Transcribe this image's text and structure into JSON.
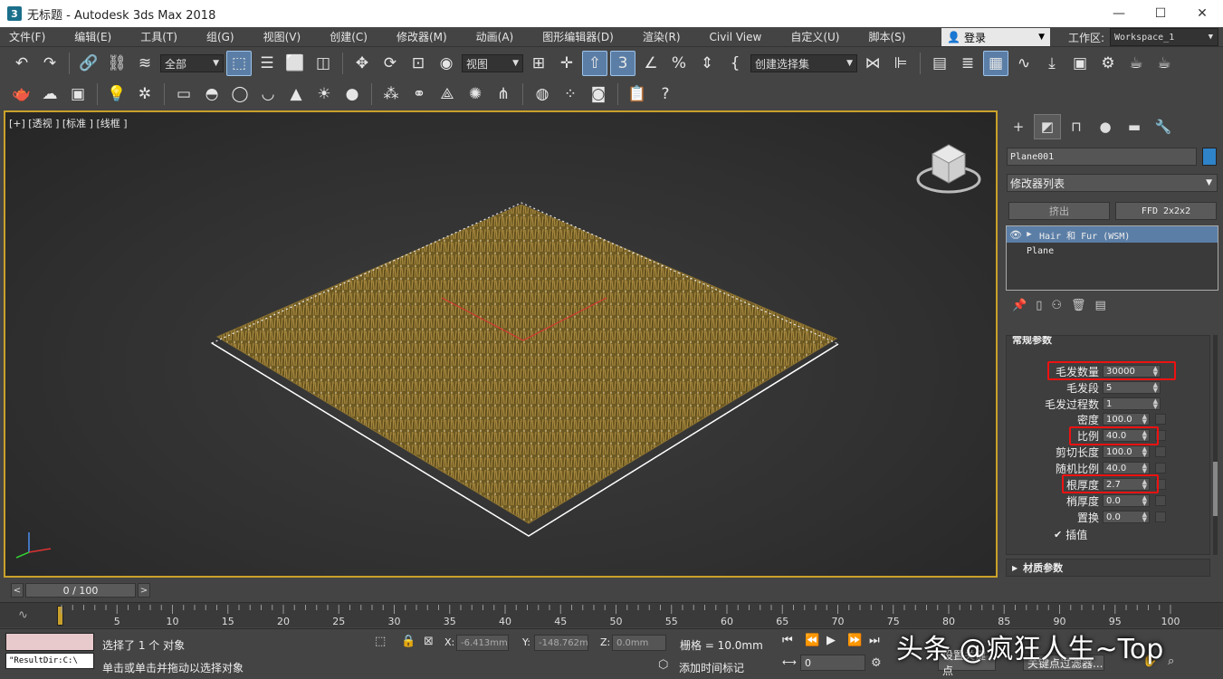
{
  "window": {
    "title": "无标题 - Autodesk 3ds Max 2018",
    "logo": "3",
    "minimize": "—",
    "maximize": "☐",
    "close": "✕"
  },
  "menu": [
    "文件(F)",
    "编辑(E)",
    "工具(T)",
    "组(G)",
    "视图(V)",
    "创建(C)",
    "修改器(M)",
    "动画(A)",
    "图形编辑器(D)",
    "渲染(R)",
    "Civil View",
    "自定义(U)",
    "脚本(S)"
  ],
  "login": {
    "icon": "👤",
    "label": "登录"
  },
  "workspace": {
    "label": "工作区:",
    "value": "Workspace_1"
  },
  "toolbar": {
    "filter": "全部",
    "ref_coord": "视图",
    "selection_set": "创建选择集"
  },
  "viewport": {
    "label": "[+] [透视 ] [标准 ] [线框 ]"
  },
  "panel": {
    "object_name": "Plane001",
    "object_color": "#2f83c8",
    "modifier_list": "修改器列表",
    "btn_extrude": "挤出",
    "btn_ffd": "FFD 2x2x2",
    "stack": [
      "Hair 和 Fur (WSM)",
      "Plane"
    ],
    "rollout_title": "常规参数",
    "params": [
      {
        "label": "毛发数量",
        "value": "30000"
      },
      {
        "label": "毛发段",
        "value": "5"
      },
      {
        "label": "毛发过程数",
        "value": "1"
      },
      {
        "label": "密度",
        "value": "100.0"
      },
      {
        "label": "比例",
        "value": "40.0"
      },
      {
        "label": "剪切长度",
        "value": "100.0"
      },
      {
        "label": "随机比例",
        "value": "40.0"
      },
      {
        "label": "根厚度",
        "value": "2.7"
      },
      {
        "label": "梢厚度",
        "value": "0.0"
      },
      {
        "label": "置换",
        "value": "0.0"
      }
    ],
    "interpolate": "插值",
    "material_rollout": "材质参数"
  },
  "timeline": {
    "frame_display": "0 / 100",
    "ticks": [
      "5",
      "10",
      "15",
      "20",
      "25",
      "30",
      "35",
      "40",
      "45",
      "50",
      "55",
      "60",
      "65",
      "70",
      "75",
      "80",
      "85",
      "90",
      "95",
      "100"
    ]
  },
  "status": {
    "maxscript_output": "\"ResultDir:C:\\",
    "selected": "选择了 1 个 对象",
    "hint": "单击或单击并拖动以选择对象",
    "x_label": "X:",
    "x_value": "-6.413mm",
    "y_label": "Y:",
    "y_value": "-148.762m",
    "z_label": "Z:",
    "z_value": "0.0mm",
    "grid": "栅格 = 10.0mm",
    "add_time_tag": "添加时间标记",
    "frame": "0",
    "set_key": "设置关键点",
    "key_filters": "关键点过滤器..."
  },
  "watermark": "头条 @疯狂人生~Top"
}
